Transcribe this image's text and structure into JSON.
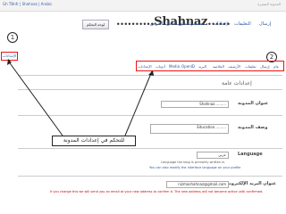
{
  "topbar": {
    "left_link": "Gh TBnfr | Shahnaz | Arabic",
    "right_link": "المدونة المميزة"
  },
  "header": {
    "blog_title": "..........Shahnaz......",
    "blog_list_button": "لوحة التحكم",
    "tabs": [
      "إرسال",
      "التعليقات",
      "إعدادات",
      "تصميم",
      "تحقيق الدخل",
      "العرض"
    ]
  },
  "sidebar": {
    "active_item": "الإعدادات"
  },
  "subtabs": [
    "عام",
    "إرسال",
    "تعليقات",
    "الأرشيف",
    "الخلاصة",
    "البريد",
    "OpenID",
    "Media",
    "أذونات",
    "الإعدادات"
  ],
  "section_heading": "إعدادات عامة",
  "fields": {
    "title_label": "عنوان المدونة",
    "title_value": "Shahnaz..........",
    "desc_label": "وصف المدونة",
    "desc_value": "Education..........",
    "language_label": "Language",
    "language_value": "عربي",
    "language_note": "Language the blog is primarily written in.",
    "language_link": "You can also modify the interface language on your profile",
    "email_label": "عنوان البريد الإلكتروني",
    "email_value": "nizmashahnaz@gmail.com",
    "email_note": "If you change this we will send you an email at your new address to confirm it. The new address will not become active until confirmed."
  },
  "callouts": {
    "settings_text": "للتحكم في إعدادات المدونة",
    "num1": "1",
    "num2": "2"
  },
  "colors": {
    "highlight": "#ee1111",
    "link": "#2856a5"
  }
}
